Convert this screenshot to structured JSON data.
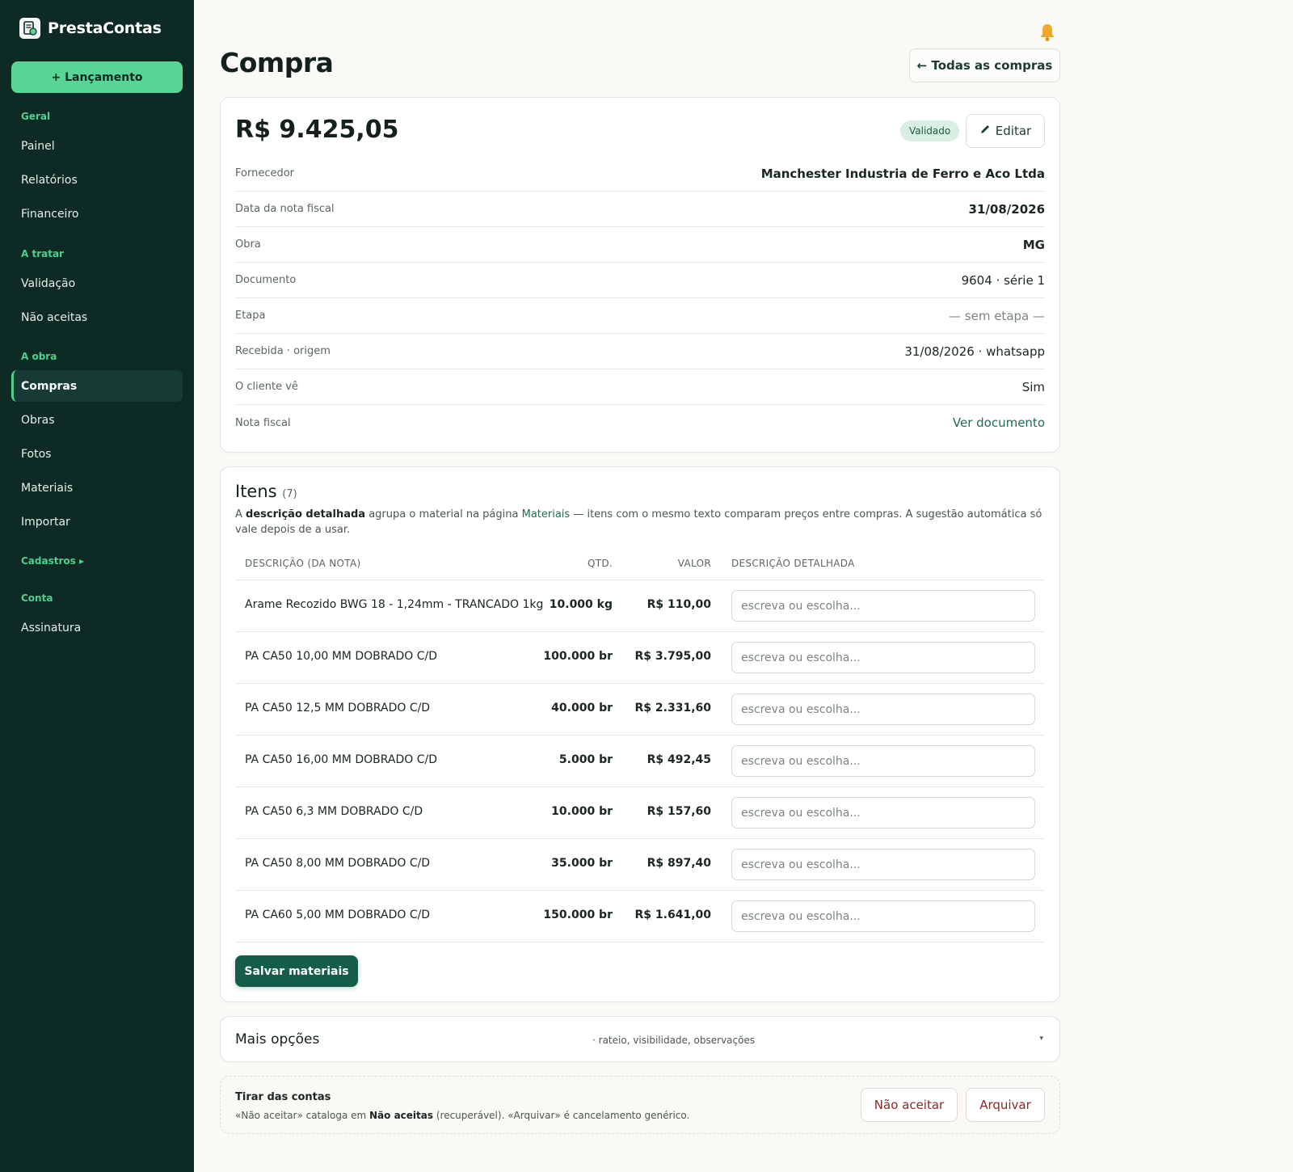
{
  "app": {
    "name": "PrestaContas"
  },
  "sidebar": {
    "new_button": "+ Lançamento",
    "sections": [
      {
        "title": "Geral",
        "items": [
          "Painel",
          "Relatórios",
          "Financeiro"
        ]
      },
      {
        "title": "A tratar",
        "items": [
          "Validação",
          "Não aceitas"
        ]
      },
      {
        "title": "A obra",
        "items": [
          "Compras",
          "Obras",
          "Fotos",
          "Materiais",
          "Importar"
        ]
      },
      {
        "title": "Cadastros ▸",
        "items": []
      },
      {
        "title": "Conta",
        "items": [
          "Assinatura"
        ]
      }
    ],
    "active_item": "Compras"
  },
  "header": {
    "title": "Compra",
    "back_button": "← Todas as compras",
    "notification_icon": "bell-icon"
  },
  "summary": {
    "amount": "R$ 9.425,05",
    "status_badge": "Validado",
    "edit_button": "Editar",
    "edit_icon": "pencil-icon",
    "fields": [
      {
        "label": "Fornecedor",
        "value": "Manchester Industria de Ferro e Aco Ltda"
      },
      {
        "label": "Data da nota fiscal",
        "value": "31/08/2026"
      },
      {
        "label": "Obra",
        "value": "MG"
      },
      {
        "label": "Documento",
        "value": "9604 · série 1"
      },
      {
        "label": "Etapa",
        "value": "— sem etapa —"
      },
      {
        "label": "Recebida · origem",
        "value": "31/08/2026 · whatsapp"
      },
      {
        "label": "O cliente vê",
        "value": "Sim"
      },
      {
        "label": "Nota fiscal",
        "value": "Ver documento"
      }
    ]
  },
  "items": {
    "title": "Itens",
    "count": "(7)",
    "desc_parts": [
      "A ",
      "descrição detalhada",
      " agrupa o material na página ",
      "Materiais",
      " — itens com o mesmo texto comparam preços entre compras. A sugestão automática só vale depois de a usar."
    ],
    "columns": [
      "DESCRIÇÃO (DA NOTA)",
      "QTD.",
      "VALOR",
      "DESCRIÇÃO DETALHADA"
    ],
    "input_placeholder": "escreva ou escolha...",
    "rows": [
      {
        "desc": "Arame Recozido BWG 18 - 1,24mm - TRANCADO 1kg",
        "qtd": "10.000 kg",
        "valor": "R$ 110,00"
      },
      {
        "desc": "PA CA50 10,00 MM DOBRADO C/D",
        "qtd": "100.000 br",
        "valor": "R$ 3.795,00"
      },
      {
        "desc": "PA CA50 12,5 MM DOBRADO C/D",
        "qtd": "40.000 br",
        "valor": "R$ 2.331,60"
      },
      {
        "desc": "PA CA50 16,00 MM DOBRADO C/D",
        "qtd": "5.000 br",
        "valor": "R$ 492,45"
      },
      {
        "desc": "PA CA50 6,3 MM DOBRADO C/D",
        "qtd": "10.000 br",
        "valor": "R$ 157,60"
      },
      {
        "desc": "PA CA50 8,00 MM DOBRADO C/D",
        "qtd": "35.000 br",
        "valor": "R$ 897,40"
      },
      {
        "desc": "PA CA60 5,00 MM DOBRADO C/D",
        "qtd": "150.000 br",
        "valor": "R$ 1.641,00"
      }
    ],
    "save_button": "Salvar materiais"
  },
  "more_options": {
    "title": "Mais opções",
    "subtitle": "· rateio, visibilidade, observações",
    "caret": "▾"
  },
  "remove": {
    "title": "Tirar das contas",
    "desc_parts": [
      "«Não aceitar» cataloga em ",
      "Não aceitas",
      " (recuperável). «Arquivar» é cancelamento genérico."
    ],
    "reject_button": "Não aceitar",
    "archive_button": "Arquivar"
  },
  "colors": {
    "sidebar_bg": "#0d2a25",
    "accent": "#58d495",
    "primary_button": "#155c49",
    "danger_text": "#8a2a22"
  }
}
